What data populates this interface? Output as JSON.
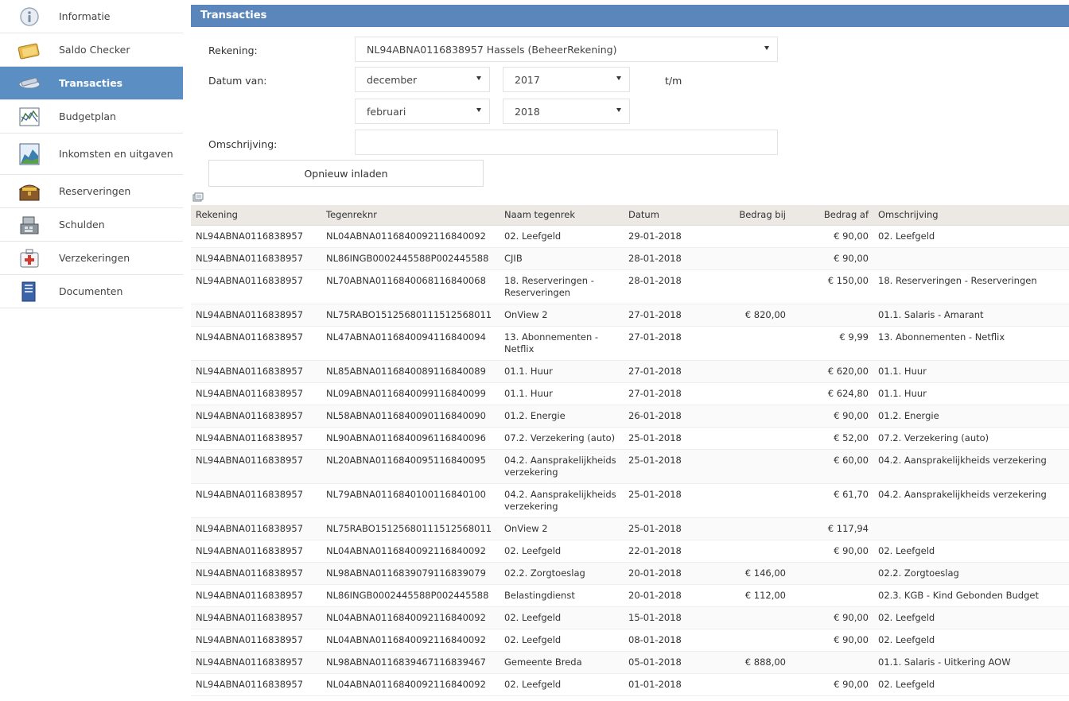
{
  "sidebar": {
    "items": [
      {
        "label": "Informatie",
        "icon": "info-icon"
      },
      {
        "label": "Saldo Checker",
        "icon": "wallet-icon"
      },
      {
        "label": "Transacties",
        "icon": "transactions-icon",
        "active": true
      },
      {
        "label": "Budgetplan",
        "icon": "budget-chart-icon"
      },
      {
        "label": "Inkomsten en uitgaven",
        "icon": "income-chart-icon"
      },
      {
        "label": "Reserveringen",
        "icon": "treasure-chest-icon"
      },
      {
        "label": "Schulden",
        "icon": "cash-register-icon"
      },
      {
        "label": "Verzekeringen",
        "icon": "first-aid-kit-icon"
      },
      {
        "label": "Documenten",
        "icon": "documents-icon"
      }
    ]
  },
  "panel": {
    "title": "Transacties",
    "rekening_label": "Rekening:",
    "rekening_value": "NL94ABNA0116838957 Hassels (BeheerRekening)",
    "datum_van_label": "Datum van:",
    "from_month": "december",
    "from_year": "2017",
    "tm_label": "t/m",
    "to_month": "februari",
    "to_year": "2018",
    "omschrijving_label": "Omschrijving:",
    "omschrijving_value": "",
    "reload_button": "Opnieuw inladen"
  },
  "table": {
    "headers": [
      "Rekening",
      "Tegenreknr",
      "Naam tegenrek",
      "Datum",
      "Bedrag bij",
      "Bedrag af",
      "Omschrijving"
    ],
    "rows": [
      [
        "NL94ABNA0116838957",
        "NL04ABNA0116840092116840092",
        "02. Leefgeld",
        "29-01-2018",
        "",
        "€ 90,00",
        "02. Leefgeld"
      ],
      [
        "NL94ABNA0116838957",
        "NL86INGB0002445588P002445588",
        "CJIB",
        "28-01-2018",
        "",
        "€ 90,00",
        ""
      ],
      [
        "NL94ABNA0116838957",
        "NL70ABNA0116840068116840068",
        "18. Reserveringen - Reserveringen",
        "28-01-2018",
        "",
        "€ 150,00",
        "18. Reserveringen - Reserveringen"
      ],
      [
        "NL94ABNA0116838957",
        "NL75RABO1512568011151256801​1",
        "OnView 2",
        "27-01-2018",
        "€ 820,00",
        "",
        "01.1. Salaris - Amarant"
      ],
      [
        "NL94ABNA0116838957",
        "NL47ABNA0116840094116840094",
        "13. Abonnementen - Netflix",
        "27-01-2018",
        "",
        "€ 9,99",
        "13. Abonnementen - Netflix"
      ],
      [
        "NL94ABNA0116838957",
        "NL85ABNA0116840089116840089",
        "01.1. Huur",
        "27-01-2018",
        "",
        "€ 620,00",
        "01.1. Huur"
      ],
      [
        "NL94ABNA0116838957",
        "NL09ABNA0116840099116840099",
        "01.1. Huur",
        "27-01-2018",
        "",
        "€ 624,80",
        "01.1. Huur"
      ],
      [
        "NL94ABNA0116838957",
        "NL58ABNA0116840090116840090",
        "01.2. Energie",
        "26-01-2018",
        "",
        "€ 90,00",
        "01.2. Energie"
      ],
      [
        "NL94ABNA0116838957",
        "NL90ABNA0116840096116840096",
        "07.2. Verzekering (auto)",
        "25-01-2018",
        "",
        "€ 52,00",
        "07.2. Verzekering (auto)"
      ],
      [
        "NL94ABNA0116838957",
        "NL20ABNA0116840095116840095",
        "04.2. Aansprakelijkheids verzekering",
        "25-01-2018",
        "",
        "€ 60,00",
        "04.2. Aansprakelijkheids verzekering"
      ],
      [
        "NL94ABNA0116838957",
        "NL79ABNA0116840100116840100",
        "04.2. Aansprakelijkheids verzekering",
        "25-01-2018",
        "",
        "€ 61,70",
        "04.2. Aansprakelijkheids verzekering"
      ],
      [
        "NL94ABNA0116838957",
        "NL75RABO1512568011151256801​1",
        "OnView 2",
        "25-01-2018",
        "",
        "€ 117,94",
        ""
      ],
      [
        "NL94ABNA0116838957",
        "NL04ABNA0116840092116840092",
        "02. Leefgeld",
        "22-01-2018",
        "",
        "€ 90,00",
        "02. Leefgeld"
      ],
      [
        "NL94ABNA0116838957",
        "NL98ABNA0116839079116839079",
        "02.2. Zorgtoeslag",
        "20-01-2018",
        "€ 146,00",
        "",
        "02.2. Zorgtoeslag"
      ],
      [
        "NL94ABNA0116838957",
        "NL86INGB0002445588P002445588",
        "Belastingdienst",
        "20-01-2018",
        "€ 112,00",
        "",
        "02.3. KGB - Kind Gebonden Budget"
      ],
      [
        "NL94ABNA0116838957",
        "NL04ABNA0116840092116840092",
        "02. Leefgeld",
        "15-01-2018",
        "",
        "€ 90,00",
        "02. Leefgeld"
      ],
      [
        "NL94ABNA0116838957",
        "NL04ABNA0116840092116840092",
        "02. Leefgeld",
        "08-01-2018",
        "",
        "€ 90,00",
        "02. Leefgeld"
      ],
      [
        "NL94ABNA0116838957",
        "NL98ABNA0116839467116839467",
        "Gemeente Breda",
        "05-01-2018",
        "€ 888,00",
        "",
        "01.1. Salaris - Uitkering AOW"
      ],
      [
        "NL94ABNA0116838957",
        "NL04ABNA0116840092116840092",
        "02. Leefgeld",
        "01-01-2018",
        "",
        "€ 90,00",
        "02. Leefgeld"
      ]
    ]
  },
  "colors": {
    "header_bar": "#5b86bb",
    "active_nav": "#5b8fc4",
    "table_header": "#ece9e5"
  }
}
